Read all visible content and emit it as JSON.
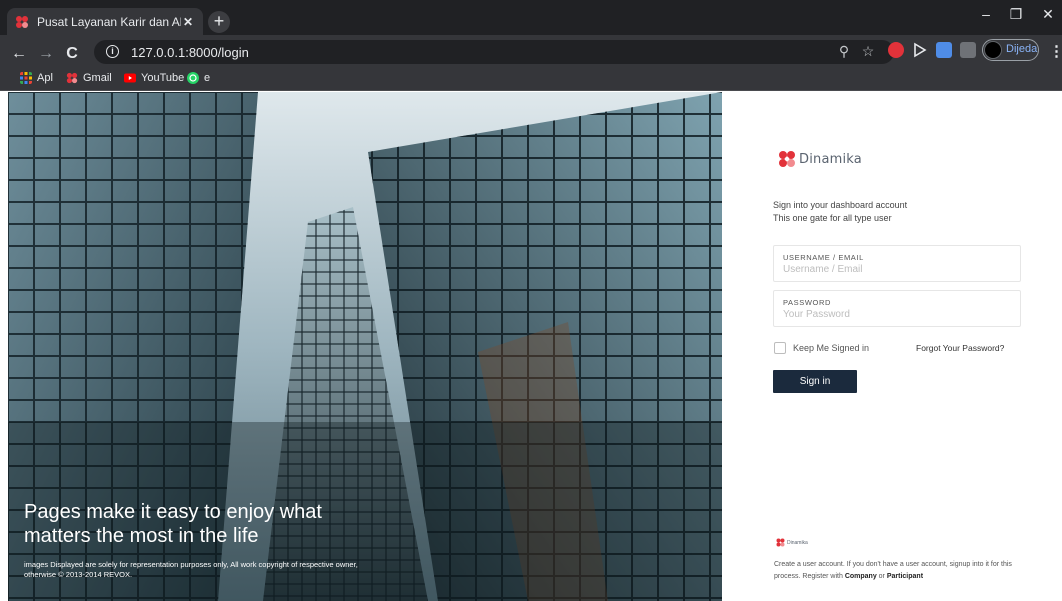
{
  "browser": {
    "tab_title": "Pusat Layanan Karir dan Alumni",
    "tab_close": "✕",
    "new_tab": "+",
    "url": "127.0.0.1:8000/login",
    "profile_name": "Dijeda",
    "window_controls": {
      "minimize": "–",
      "maximize": "❐",
      "close": "✕"
    },
    "nav": {
      "back": "←",
      "forward": "→",
      "reload": "C"
    },
    "bookmarks": [
      {
        "label": "Apl",
        "icon": "apps-grid-icon"
      },
      {
        "label": "Gmail",
        "icon": "dinamika-favicon-icon"
      },
      {
        "label": "YouTube",
        "icon": "youtube-icon"
      },
      {
        "label": "e",
        "icon": "whatsapp-icon"
      }
    ]
  },
  "hero": {
    "headline": "Pages make it easy to enjoy what matters the most in the life",
    "note": "images Displayed are solely for representation purposes only, All work copyright of respective owner, otherwise © 2013-2014 REVOX."
  },
  "login": {
    "logo_text": "Dinamika",
    "intro_line1": "Sign into your dashboard account",
    "intro_line2": "This one gate for all type user",
    "username_label": "USERNAME / EMAIL",
    "username_placeholder": "Username / Email",
    "password_label": "PASSWORD",
    "password_placeholder": "Your Password",
    "keep_signed_in": "Keep Me Signed in",
    "forgot_password": "Forgot Your Password?",
    "sign_in": "Sign in"
  },
  "footer": {
    "logo_text": "Dinamika",
    "text_part1": "Create a user account. If you don't have a user account, signup into it for this process. Register with ",
    "company": "Company",
    "or": " or ",
    "participant": "Participant"
  },
  "colors": {
    "brand_red": "#e2323a",
    "button_navy": "#1b2a3d",
    "chrome_dark": "#202124",
    "chrome_toolbar": "#35363a"
  }
}
